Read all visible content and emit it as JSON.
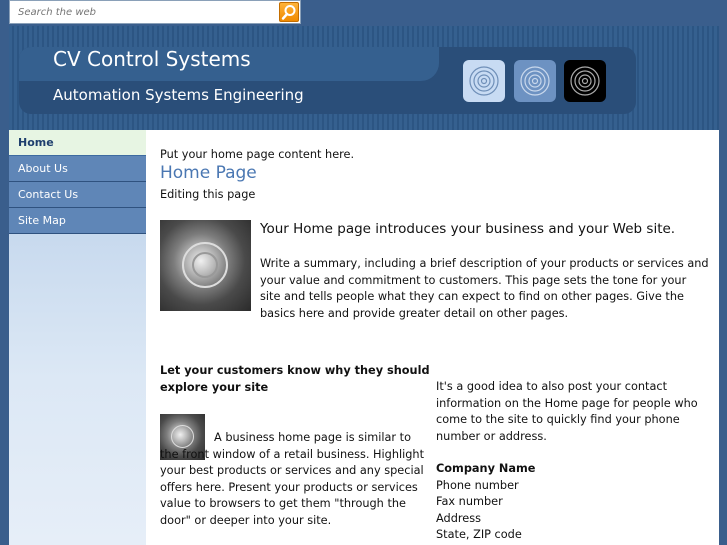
{
  "search": {
    "placeholder": "Search the web"
  },
  "banner": {
    "title": "CV Control Systems",
    "subtitle": "Automation Systems Engineering"
  },
  "nav": {
    "items": [
      {
        "label": "Home",
        "active": true
      },
      {
        "label": "About Us",
        "active": false
      },
      {
        "label": "Contact Us",
        "active": false
      },
      {
        "label": "Site Map",
        "active": false
      }
    ]
  },
  "main": {
    "intro": "Put your home page content here.",
    "heading": "Home Page",
    "editing": "Editing this page",
    "summary_heading": "Your Home page introduces your business and your Web site.",
    "summary_text": "Write a summary, including a brief description of your products or services and your value and commitment to customers. This page sets the tone for your site and tells people what they can expect to find on other pages. Give the basics here and provide greater detail on other pages.",
    "why_heading": "Let your customers know why they should explore your site",
    "window_text": "A business home page is similar to the front window of a retail business. Highlight your best products or services and any special offers here. Present your products or services value to browsers to get them \"through the door\" or deeper into your site.",
    "contact_text": "It's a good idea to also post your contact information on the Home page for people who come to the site to quickly find your phone number or address.",
    "company_name": "Company Name",
    "phone": "Phone number",
    "fax": "Fax number",
    "address": "Address",
    "state": "State, ZIP code"
  },
  "colors": {
    "accent": "#4a77b2",
    "nav_bg": "#5f86b7",
    "nav_active_bg": "#e7f5e3",
    "search_button": "#f08a00",
    "page_bg": "#3a5e8c"
  },
  "icons": {
    "search_button": "search-icon",
    "badges": [
      "concentric-circles-icon",
      "concentric-circles-icon",
      "concentric-circles-icon"
    ]
  }
}
